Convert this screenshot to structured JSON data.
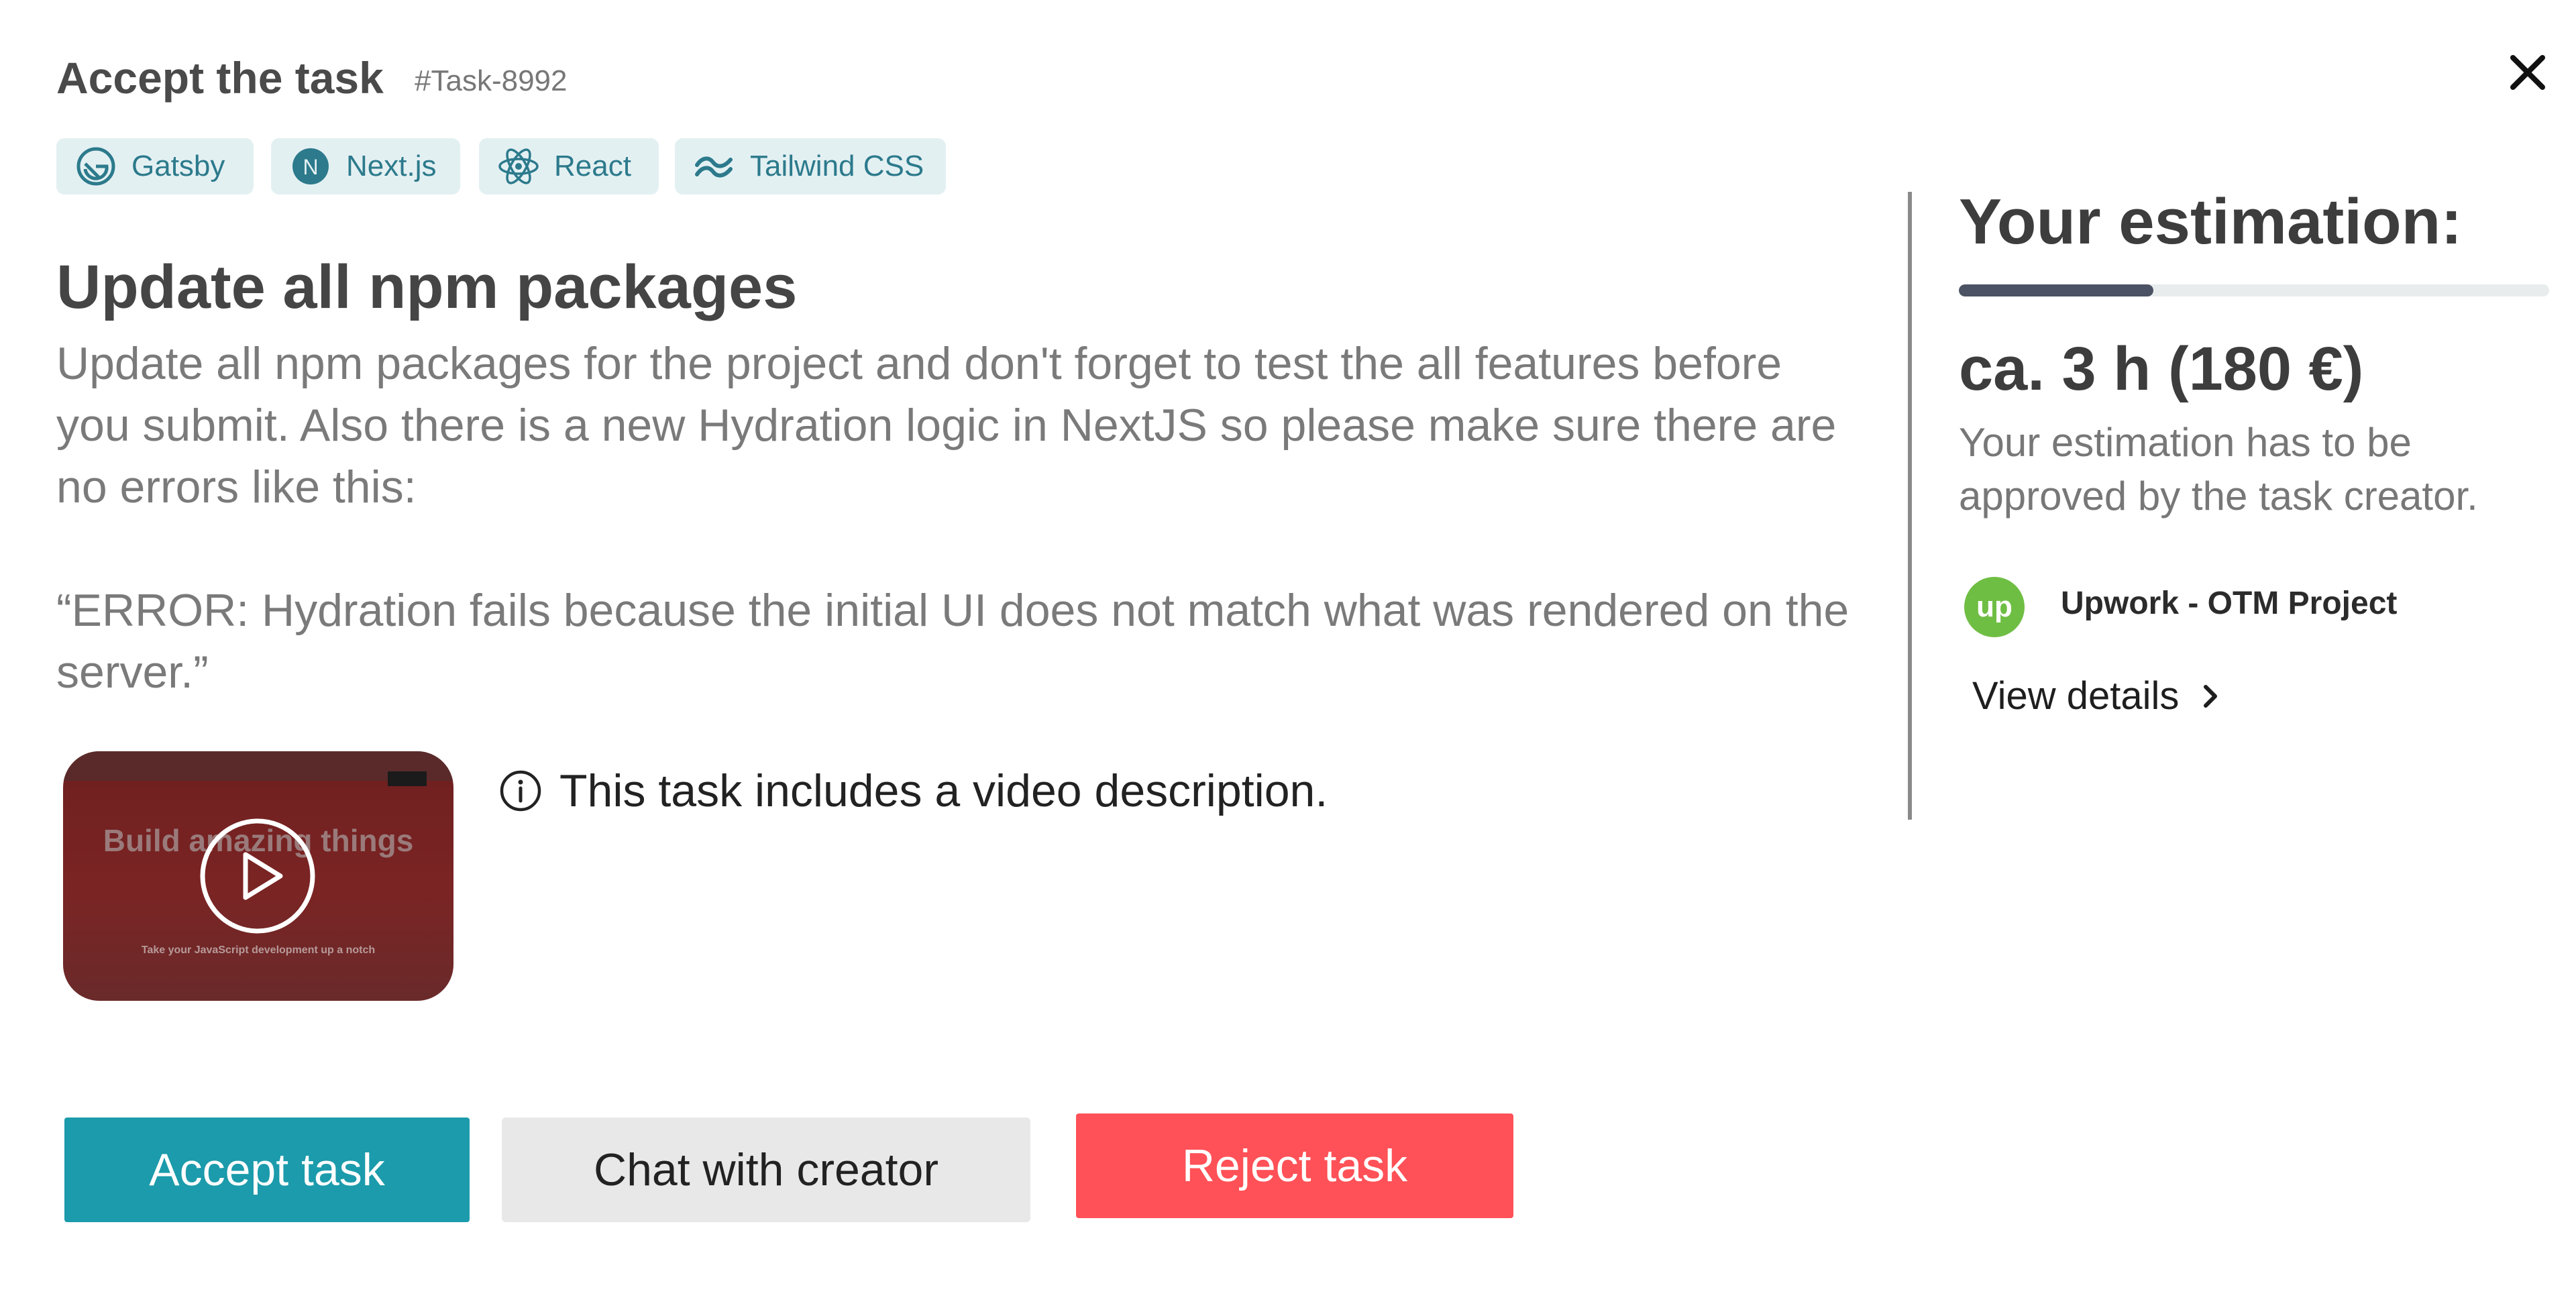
{
  "header": {
    "title": "Accept the task",
    "task_id": "#Task-8992"
  },
  "tags": [
    {
      "label": "Gatsby",
      "icon": "gatsby-icon"
    },
    {
      "label": "Next.js",
      "icon": "nextjs-icon"
    },
    {
      "label": "React",
      "icon": "react-icon"
    },
    {
      "label": "Tailwind CSS",
      "icon": "tailwind-icon"
    }
  ],
  "task": {
    "title": "Update all npm packages",
    "description_1": "Update all npm packages for the project and don't forget to test the all features before you submit. Also there is a new Hydration logic in NextJS so please make sure there are no errors like this:",
    "description_2": "“ERROR: Hydration fails because the initial UI does not match what was rendered on the server.”"
  },
  "video": {
    "thumbnail_headline": "Build amazing things",
    "thumbnail_subline": "Take your JavaScript development up a notch",
    "info_text": "This task includes a video description."
  },
  "buttons": {
    "accept": "Accept task",
    "chat": "Chat with creator",
    "reject": "Reject task"
  },
  "estimation": {
    "title": "Your estimation:",
    "progress": 0.33,
    "value": "ca. 3 h (180 €)",
    "note": "Your estimation has to be approved by the task creator.",
    "client_logo_text": "up",
    "client_name": "Upwork - OTM Project",
    "view_details": "View details"
  },
  "colors": {
    "accent": "#1b9bab",
    "reject": "#ff5157",
    "tag_bg": "#e3f0f2",
    "tag_text": "#2c7a8c",
    "upwork_green": "#6fbe44"
  }
}
